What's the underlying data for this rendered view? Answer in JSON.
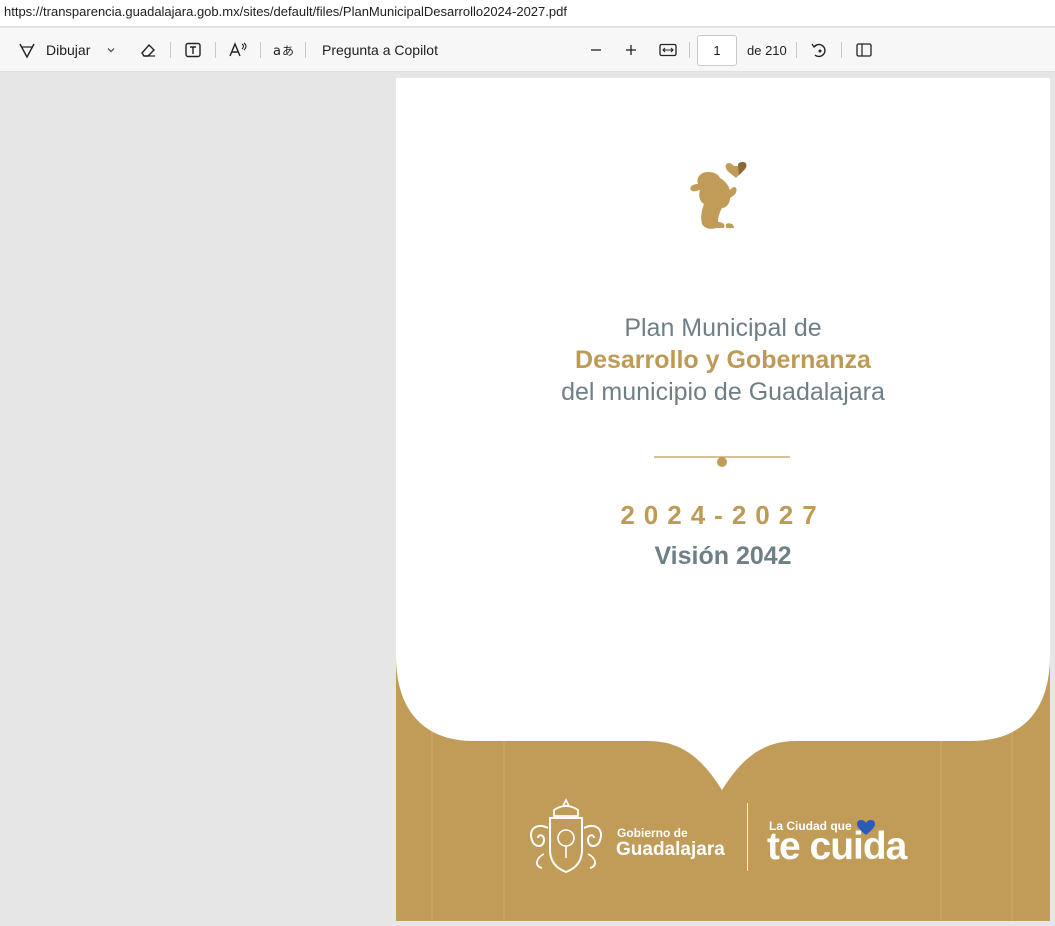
{
  "browser": {
    "url": "https://transparencia.guadalajara.gob.mx/sites/default/files/PlanMunicipalDesarrollo2024-2027.pdf"
  },
  "toolbar": {
    "draw_label": "Dibujar",
    "copilot_label": "Pregunta a Copilot",
    "page_current": "1",
    "page_total_label": "de 210"
  },
  "document": {
    "title_line1": "Plan Municipal de",
    "title_line2": "Desarrollo y Gobernanza",
    "title_line3": "del municipio de Guadalajara",
    "years": "2024-2027",
    "vision": "Visión 2042",
    "footer": {
      "gov_line1": "Gobierno de",
      "gov_line2": "Guadalajara",
      "slogan_line1": "La Ciudad que",
      "slogan_line2": "te cuida"
    },
    "colors": {
      "gold": "#c09c58",
      "gray_text": "#6f7f86",
      "heart_blue": "#2b5bb8"
    }
  }
}
